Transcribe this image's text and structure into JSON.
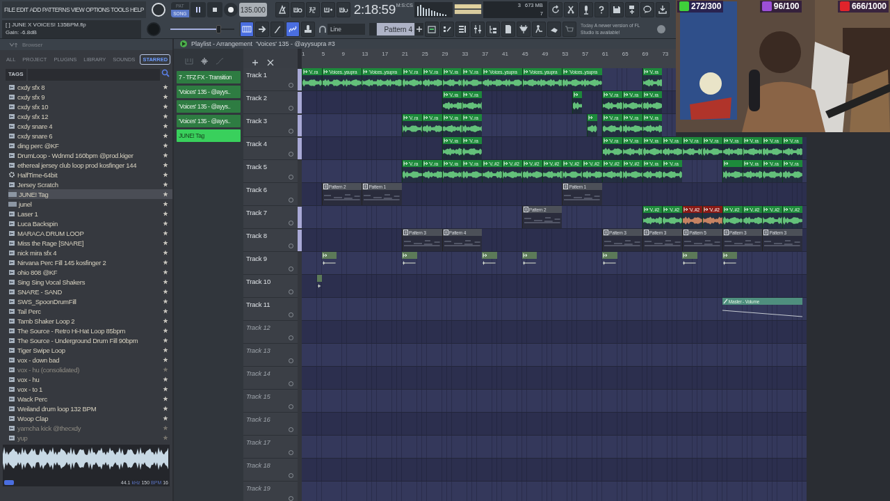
{
  "menu": [
    "FILE",
    "EDIT",
    "ADD",
    "PATTERNS",
    "VIEW",
    "OPTIONS",
    "TOOLS",
    "HELP"
  ],
  "hint": {
    "title": "[   ] JUNE X VOICES! 135BPM.flp",
    "detail": "Gain:  -6.8dB"
  },
  "transport": {
    "modes": [
      {
        "label": "PAT",
        "selected": false
      },
      {
        "label": "SONG",
        "selected": true
      }
    ],
    "tempo": "135.000",
    "pitch": {
      "level": 0.75
    }
  },
  "time": {
    "value": "2:18:59",
    "unit": "M:S:CS"
  },
  "cpu": {
    "cores": "3",
    "memory": "673 MB",
    "polyphony": "7"
  },
  "record_toggles": [
    {
      "on": true
    },
    {
      "on": false
    },
    {
      "on": false
    },
    {
      "on": true
    },
    {
      "on": false
    }
  ],
  "snap": "Line",
  "pattern": "Pattern 4",
  "news": {
    "day": "Today",
    "text": "A newer version of FL Studio is available!"
  },
  "browser": {
    "title": "Browser",
    "tabs": [
      {
        "label": "ALL",
        "selected": false
      },
      {
        "label": "PROJECT",
        "selected": false
      },
      {
        "label": "PLUGINS",
        "selected": false
      },
      {
        "label": "LIBRARY",
        "selected": false
      },
      {
        "label": "SOUNDS",
        "selected": false
      },
      {
        "label": "STARRED",
        "selected": true
      }
    ],
    "tags_label": "TAGS",
    "items": [
      {
        "name": "cxdy sfx 8",
        "kind": "audio",
        "selected": false,
        "dimmed": false
      },
      {
        "name": "cxdy sfx 9",
        "kind": "audio",
        "selected": false,
        "dimmed": false
      },
      {
        "name": "cxdy sfx 10",
        "kind": "audio",
        "selected": false,
        "dimmed": false
      },
      {
        "name": "cxdy sfx 12",
        "kind": "audio",
        "selected": false,
        "dimmed": false
      },
      {
        "name": "cxdy snare 4",
        "kind": "audio",
        "selected": false,
        "dimmed": false
      },
      {
        "name": "cxdy snare 6",
        "kind": "audio",
        "selected": false,
        "dimmed": false
      },
      {
        "name": "ding perc @KF",
        "kind": "audio",
        "selected": false,
        "dimmed": false
      },
      {
        "name": "DrumLoop - Wdnmd 160bpm @prod.kiger",
        "kind": "audio",
        "selected": false,
        "dimmed": false
      },
      {
        "name": "ethereal jersey club loop prod kosfinger 144",
        "kind": "audio",
        "selected": false,
        "dimmed": false
      },
      {
        "name": "HalfTime-64bit",
        "kind": "plugin",
        "selected": false,
        "dimmed": false
      },
      {
        "name": "Jersey Scratch",
        "kind": "audio",
        "selected": false,
        "dimmed": false
      },
      {
        "name": "JUNE! Tag",
        "kind": "mp3",
        "selected": true,
        "dimmed": false
      },
      {
        "name": "junel",
        "kind": "mp3",
        "selected": false,
        "dimmed": false
      },
      {
        "name": "Laser 1",
        "kind": "audio",
        "selected": false,
        "dimmed": false
      },
      {
        "name": "Luca Backspin",
        "kind": "audio",
        "selected": false,
        "dimmed": false
      },
      {
        "name": "MARACA DRUM LOOP",
        "kind": "audio",
        "selected": false,
        "dimmed": false
      },
      {
        "name": "Miss the Rage [SNARE]",
        "kind": "audio",
        "selected": false,
        "dimmed": false
      },
      {
        "name": "nick mira sfx 4",
        "kind": "audio",
        "selected": false,
        "dimmed": false
      },
      {
        "name": "Nirvana Perc Fill 145 kosfinger 2",
        "kind": "audio",
        "selected": false,
        "dimmed": false
      },
      {
        "name": "ohio 808 @KF",
        "kind": "audio",
        "selected": false,
        "dimmed": false
      },
      {
        "name": "Sing Sing Vocal Shakers",
        "kind": "audio",
        "selected": false,
        "dimmed": false
      },
      {
        "name": "SNARE - SAND",
        "kind": "audio",
        "selected": false,
        "dimmed": false
      },
      {
        "name": "SWS_SpoonDrumFill",
        "kind": "audio",
        "selected": false,
        "dimmed": false
      },
      {
        "name": "Tail Perc",
        "kind": "audio",
        "selected": false,
        "dimmed": false
      },
      {
        "name": "Tamb Shaker Loop 2",
        "kind": "audio",
        "selected": false,
        "dimmed": false
      },
      {
        "name": "The Source - Retro Hi-Hat Loop 85bpm",
        "kind": "audio",
        "selected": false,
        "dimmed": false
      },
      {
        "name": "The Source - Underground Drum Fill 90bpm",
        "kind": "audio",
        "selected": false,
        "dimmed": false
      },
      {
        "name": "Tiger Swipe Loop",
        "kind": "audio",
        "selected": false,
        "dimmed": false
      },
      {
        "name": "vox - down bad",
        "kind": "audio",
        "selected": false,
        "dimmed": false
      },
      {
        "name": "vox - hu (consolidated)",
        "kind": "audio",
        "selected": false,
        "dimmed": true
      },
      {
        "name": "vox - hu",
        "kind": "audio",
        "selected": false,
        "dimmed": false
      },
      {
        "name": "vox - to 1",
        "kind": "audio",
        "selected": false,
        "dimmed": false
      },
      {
        "name": "Wack Perc",
        "kind": "audio",
        "selected": false,
        "dimmed": false
      },
      {
        "name": "Weiland drum loop 132 BPM",
        "kind": "audio",
        "selected": false,
        "dimmed": false
      },
      {
        "name": "Woop Clap",
        "kind": "audio",
        "selected": false,
        "dimmed": false
      },
      {
        "name": "yamcha kick @thecxdy",
        "kind": "audio",
        "selected": false,
        "dimmed": true
      },
      {
        "name": "yup",
        "kind": "audio",
        "selected": false,
        "dimmed": true
      }
    ],
    "preview": {
      "rate": "44.1",
      "rate_unit": "kHz",
      "bpm": "150",
      "bpm_unit": "BPM",
      "bits": "16"
    }
  },
  "playlist": {
    "title": "Playlist - Arrangement",
    "arrangement": "'Voices' 135 - @ayysupra #3",
    "picker": [
      {
        "label": "7 - TFZ FX - Transition",
        "selected": false
      },
      {
        "label": "'Voices' 135 - @ayys..",
        "selected": false
      },
      {
        "label": "'Voices' 135 - @ayys..",
        "selected": false
      },
      {
        "label": "'Voices' 135 - @ayys..",
        "selected": false
      },
      {
        "label": "JUNE! Tag",
        "selected": true
      }
    ],
    "ruler": [
      "1",
      "5",
      "9",
      "13",
      "17",
      "21",
      "25",
      "29",
      "33",
      "37",
      "41",
      "45",
      "49",
      "53",
      "57",
      "61",
      "65",
      "69",
      "73"
    ],
    "tracks": [
      {
        "name": "Track 1",
        "marked": true,
        "empty": false,
        "clips": [
          {
            "kind": "audio",
            "label": "'V..ra",
            "selected": false
          },
          {
            "kind": "audio",
            "label": "'Voices..ysupra",
            "selected": false
          },
          {
            "kind": "audio",
            "label": "'Voices..ysupra",
            "selected": false
          },
          {
            "kind": "audio",
            "label": "'V..ra",
            "selected": false
          },
          {
            "kind": "audio",
            "label": "'V..ra",
            "selected": false
          },
          {
            "kind": "audio",
            "label": "'V..ra",
            "selected": false
          },
          {
            "kind": "audio",
            "label": "'V..ra",
            "selected": false
          },
          {
            "kind": "audio",
            "label": "'Voices..ysupra",
            "selected": false
          },
          {
            "kind": "audio",
            "label": "'Voices..ysupra",
            "selected": false
          },
          {
            "kind": "audio",
            "label": "'Voices..ysupra",
            "selected": false
          },
          {
            "kind": "audio",
            "label": "'V..ra",
            "selected": false
          }
        ]
      },
      {
        "name": "Track 2",
        "marked": true,
        "empty": false,
        "clips": [
          {
            "kind": "audio",
            "label": "'V..ra",
            "selected": false
          },
          {
            "kind": "audio",
            "label": "'V..ra",
            "selected": false
          },
          {
            "kind": "audio",
            "selected": false
          },
          {
            "kind": "audio",
            "label": "'V..ra",
            "selected": false
          },
          {
            "kind": "audio",
            "label": "'V..ra",
            "selected": false
          },
          {
            "kind": "audio",
            "label": "'V..ra",
            "selected": false
          }
        ]
      },
      {
        "name": "Track 3",
        "marked": true,
        "empty": false,
        "clips": [
          {
            "kind": "audio",
            "label": "'V..ra",
            "selected": false
          },
          {
            "kind": "audio",
            "label": "'V..ra",
            "selected": false
          },
          {
            "kind": "audio",
            "label": "'V..ra",
            "selected": false
          },
          {
            "kind": "audio",
            "label": "'V..ra",
            "selected": false
          },
          {
            "kind": "audio",
            "selected": false
          },
          {
            "kind": "audio",
            "label": "'V..ra",
            "selected": false
          },
          {
            "kind": "audio",
            "label": "'V..ra",
            "selected": false
          },
          {
            "kind": "audio",
            "label": "'V..ra",
            "selected": false
          }
        ]
      },
      {
        "name": "Track 4",
        "marked": true,
        "empty": false,
        "clips": [
          {
            "kind": "audio",
            "label": "'V..ra",
            "selected": false
          },
          {
            "kind": "audio",
            "label": "'V..ra",
            "selected": false
          },
          {
            "kind": "audio",
            "label": "'V..ra",
            "selected": false
          },
          {
            "kind": "audio",
            "label": "'V..ra",
            "selected": false
          },
          {
            "kind": "audio",
            "label": "'V..ra",
            "selected": false
          },
          {
            "kind": "audio",
            "label": "'V..ra",
            "selected": false
          },
          {
            "kind": "audio",
            "label": "'V..ra",
            "selected": false
          },
          {
            "kind": "audio",
            "label": "'V..ra",
            "selected": false
          },
          {
            "kind": "audio",
            "label": "'V..ra",
            "selected": false
          },
          {
            "kind": "audio",
            "label": "'V..ra",
            "selected": false
          },
          {
            "kind": "audio",
            "label": "'V..ra",
            "selected": false
          },
          {
            "kind": "audio",
            "label": "'V..ra",
            "selected": false
          }
        ]
      },
      {
        "name": "Track 5",
        "marked": false,
        "empty": false,
        "clips": [
          {
            "kind": "audio",
            "label": "'V..ra",
            "selected": false
          },
          {
            "kind": "audio",
            "label": "'V..ra",
            "selected": false
          },
          {
            "kind": "audio",
            "label": "'V..ra",
            "selected": false
          },
          {
            "kind": "audio",
            "label": "'V..ra",
            "selected": false
          },
          {
            "kind": "audio",
            "label": "'V..#2",
            "selected": false
          },
          {
            "kind": "audio",
            "label": "'V..#2",
            "selected": false
          },
          {
            "kind": "audio",
            "label": "'V..#2",
            "selected": false
          },
          {
            "kind": "audio",
            "label": "'V..#2",
            "selected": false
          },
          {
            "kind": "audio",
            "label": "'V..#2",
            "selected": false
          },
          {
            "kind": "audio",
            "label": "'V..#2",
            "selected": false
          },
          {
            "kind": "audio",
            "label": "'V..#2",
            "selected": false
          },
          {
            "kind": "audio",
            "label": "'V..#2",
            "selected": false
          },
          {
            "kind": "audio",
            "label": "'V..ra",
            "selected": false
          },
          {
            "kind": "audio",
            "label": "'V..ra",
            "selected": false
          },
          {
            "kind": "audio",
            "selected": false
          },
          {
            "kind": "audio",
            "label": "'V..ra",
            "selected": false
          },
          {
            "kind": "audio",
            "label": "'V..ra",
            "selected": false
          },
          {
            "kind": "audio",
            "label": "'V..ra",
            "selected": false
          }
        ]
      },
      {
        "name": "Track 6",
        "marked": false,
        "empty": false,
        "clips": [
          {
            "kind": "pattern",
            "label": "Pattern 2",
            "selected": false
          },
          {
            "kind": "pattern",
            "label": "Pattern 1",
            "selected": false
          },
          {
            "kind": "pattern",
            "label": "Pattern 1",
            "selected": false
          }
        ]
      },
      {
        "name": "Track 7",
        "marked": true,
        "empty": false,
        "clips": [
          {
            "kind": "pattern",
            "label": "Pattern 2",
            "selected": false
          },
          {
            "kind": "audio",
            "label": "'V..#2",
            "selected": false
          },
          {
            "kind": "audio",
            "label": "'V..#2",
            "selected": false
          },
          {
            "kind": "audio",
            "label": "'V..#2",
            "selected": true
          },
          {
            "kind": "audio",
            "label": "'V..#2",
            "selected": true
          },
          {
            "kind": "audio",
            "label": "'V..#2",
            "selected": false
          },
          {
            "kind": "audio",
            "label": "'V..#2",
            "selected": false
          },
          {
            "kind": "audio",
            "label": "'V..#2",
            "selected": false
          },
          {
            "kind": "audio",
            "label": "'V..#2",
            "selected": false
          }
        ]
      },
      {
        "name": "Track 8",
        "marked": true,
        "empty": false,
        "clips": [
          {
            "kind": "pattern",
            "label": "Pattern 3",
            "selected": false
          },
          {
            "kind": "pattern",
            "label": "Pattern 4",
            "selected": false
          },
          {
            "kind": "pattern",
            "label": "Pattern 3",
            "selected": false
          },
          {
            "kind": "pattern",
            "label": "Pattern 3",
            "selected": false
          },
          {
            "kind": "pattern",
            "label": "Pattern 5",
            "selected": false
          },
          {
            "kind": "pattern",
            "label": "Pattern 3",
            "selected": false
          },
          {
            "kind": "pattern",
            "label": "Pattern 3",
            "selected": false
          }
        ]
      },
      {
        "name": "Track 9",
        "marked": false,
        "empty": false,
        "clips": [
          {
            "kind": "shot",
            "selected": false
          },
          {
            "kind": "shot",
            "selected": false
          },
          {
            "kind": "shot",
            "selected": false
          },
          {
            "kind": "shot",
            "selected": false
          },
          {
            "kind": "shot",
            "selected": false
          },
          {
            "kind": "shot",
            "selected": false
          },
          {
            "kind": "shot",
            "selected": false
          }
        ]
      },
      {
        "name": "Track 10",
        "marked": false,
        "empty": false,
        "clips": [
          {
            "kind": "shot",
            "selected": false
          }
        ]
      },
      {
        "name": "Track 11",
        "marked": false,
        "empty": false,
        "clips": [
          {
            "kind": "automation",
            "label": "Master - Volume",
            "selected": false
          }
        ]
      },
      {
        "name": "Track 12",
        "marked": false,
        "empty": true
      },
      {
        "name": "Track 13",
        "marked": false,
        "empty": true
      },
      {
        "name": "Track 14",
        "marked": false,
        "empty": true
      },
      {
        "name": "Track 15",
        "marked": false,
        "empty": true
      },
      {
        "name": "Track 16",
        "marked": false,
        "empty": true
      },
      {
        "name": "Track 17",
        "marked": false,
        "empty": true
      },
      {
        "name": "Track 18",
        "marked": false,
        "empty": true
      },
      {
        "name": "Track 19",
        "marked": false,
        "empty": true
      }
    ]
  },
  "webcam": {
    "kind": "picture"
  },
  "stream_goals": [
    {
      "value": "272/300",
      "color": "#3fcf3a"
    },
    {
      "value": "96/100",
      "color": "#9b4fd6"
    },
    {
      "value": "666/1000",
      "color": "#e0242b"
    }
  ]
}
